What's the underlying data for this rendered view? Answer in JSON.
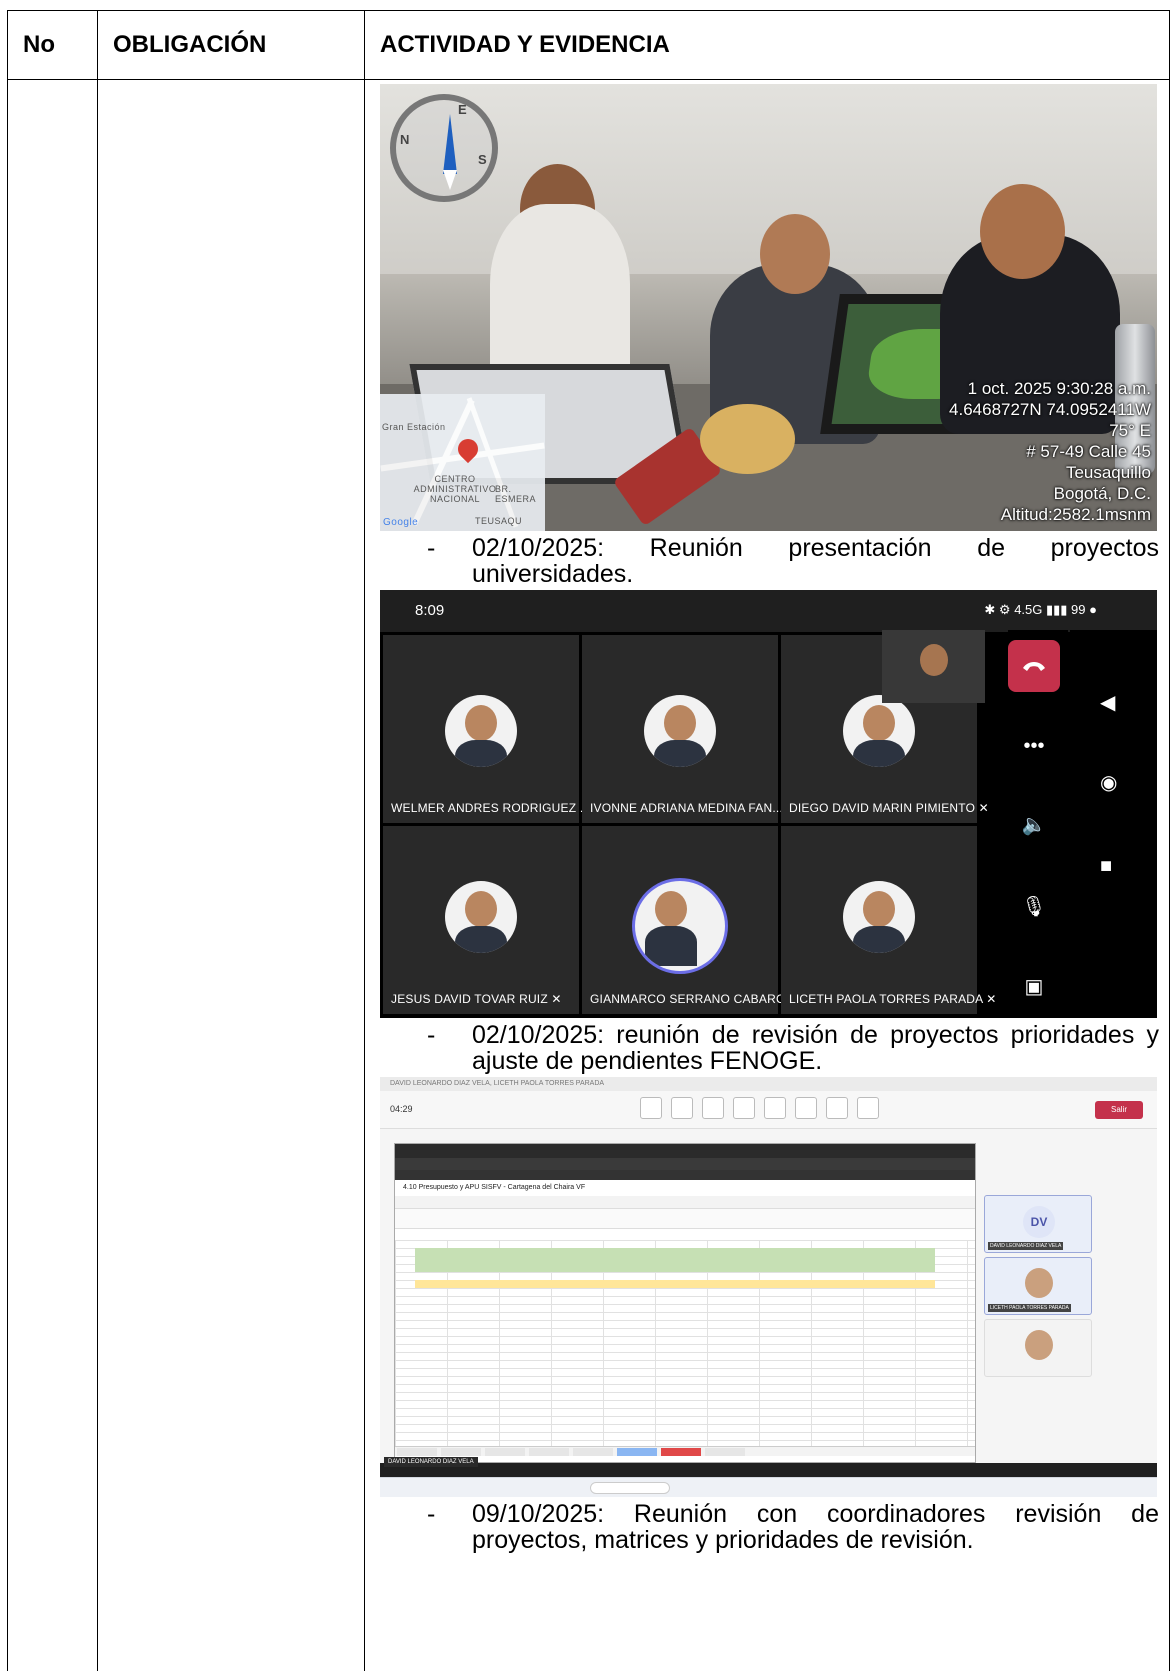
{
  "table": {
    "headers": {
      "no": "No",
      "obligacion": "OBLIGACIÓN",
      "actividad": "ACTIVIDAD Y EVIDENCIA"
    }
  },
  "evidence": [
    {
      "date_text": "02/10/2025: Reunión presentación de proyectos universidades.",
      "dash": "-",
      "photo": {
        "geotag": {
          "datetime": "1 oct. 2025 9:30:28 a.m.",
          "coords": "4.6468727N 74.0952411W",
          "heading": "75° E",
          "address": "# 57-49 Calle 45",
          "locality": "Teusaquillo",
          "city": "Bogotá, D.C.",
          "altitude": "Altitud:2582.1msnm"
        },
        "map_labels": {
          "station": "Gran Estación",
          "center": "CENTRO ADMINISTRATIVO NACIONAL",
          "barrio": "BR. ESMERA",
          "teusaquillo": "TEUSAQU",
          "google": "Google"
        }
      }
    },
    {
      "date_text": "02/10/2025: reunión de revisión de proyectos prioridades y ajuste de pendientes FENOGE.",
      "dash": "-",
      "photo": {
        "status_time": "8:09",
        "status_icons": "✱ ⚙ 4.5G ▮▮▮ 99 ●",
        "participants": [
          {
            "name": "WELMER ANDRES RODRIGUEZ ... ✕"
          },
          {
            "name": "IVONNE ADRIANA MEDINA FAN... ✕"
          },
          {
            "name": "DIEGO DAVID MARIN PIMIENTO ✕"
          },
          {
            "name": "JESUS DAVID TOVAR RUIZ ✕"
          },
          {
            "name": "GIANMARCO SERRANO CABARCAS"
          },
          {
            "name": "LICETH PAOLA TORRES PARADA ✕"
          }
        ]
      }
    },
    {
      "date_text": "09/10/2025: Reunión con coordinadores revisión de proyectos, matrices y prioridades de revisión.",
      "dash": "-",
      "photo": {
        "title": "DAVID LEONARDO DIAZ VELA, LICETH PAOLA TORRES PARADA",
        "timer": "04:29",
        "leave": "Salir",
        "file_title": "4.10 Presupuesto y APU SISFV - Cartagena del Chaira VF",
        "gallery": [
          {
            "initials": "DV",
            "label": "DAVID LEONARDO DIAZ VELA"
          },
          {
            "label": "LICETH PAOLA TORRES PARADA"
          }
        ],
        "name_chip": "DAVID LEONARDO DIAZ VELA"
      }
    }
  ],
  "colors": {
    "border": "#000000",
    "teams_end_call": "#c4314b",
    "teams_accent": "#6b6de6"
  }
}
